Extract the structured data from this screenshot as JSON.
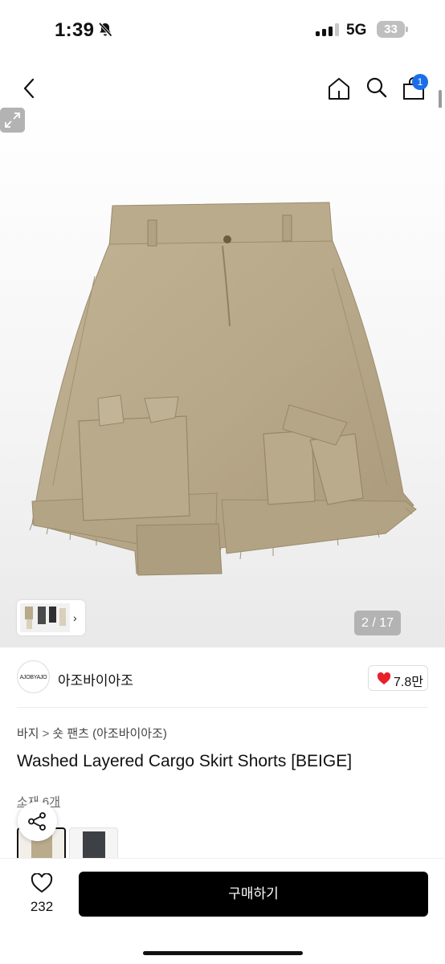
{
  "status_bar": {
    "time": "1:39",
    "network": "5G",
    "battery": "33",
    "signal_bars_active": 3,
    "signal_bars_total": 4
  },
  "top_nav": {
    "cart_count": "1"
  },
  "gallery": {
    "counter": "2 / 17",
    "thumb_arrow": "›"
  },
  "brand": {
    "logo_text": "AJOBYAJO",
    "name": "아조바이아조",
    "like_count": "7.8만"
  },
  "breadcrumb": {
    "category": "바지",
    "separator": ">",
    "subcategory": "숏 팬츠 (아조바이아조)"
  },
  "product": {
    "title": "Washed Layered Cargo Skirt Shorts [BEIGE]",
    "option_label": "소재 6개"
  },
  "bottom_bar": {
    "wish_count": "232",
    "buy_label": "구매하기"
  },
  "colors": {
    "accent_blue": "#1a6fe8",
    "heart_red": "#e8202a",
    "primary_black": "#000000",
    "product_beige": "#b9ab8c"
  },
  "icons": [
    "bell-slash-icon",
    "back-chevron-icon",
    "home-icon",
    "search-icon",
    "shopping-bag-icon",
    "expand-icon",
    "heart-filled-icon",
    "share-icon",
    "heart-outline-icon"
  ]
}
